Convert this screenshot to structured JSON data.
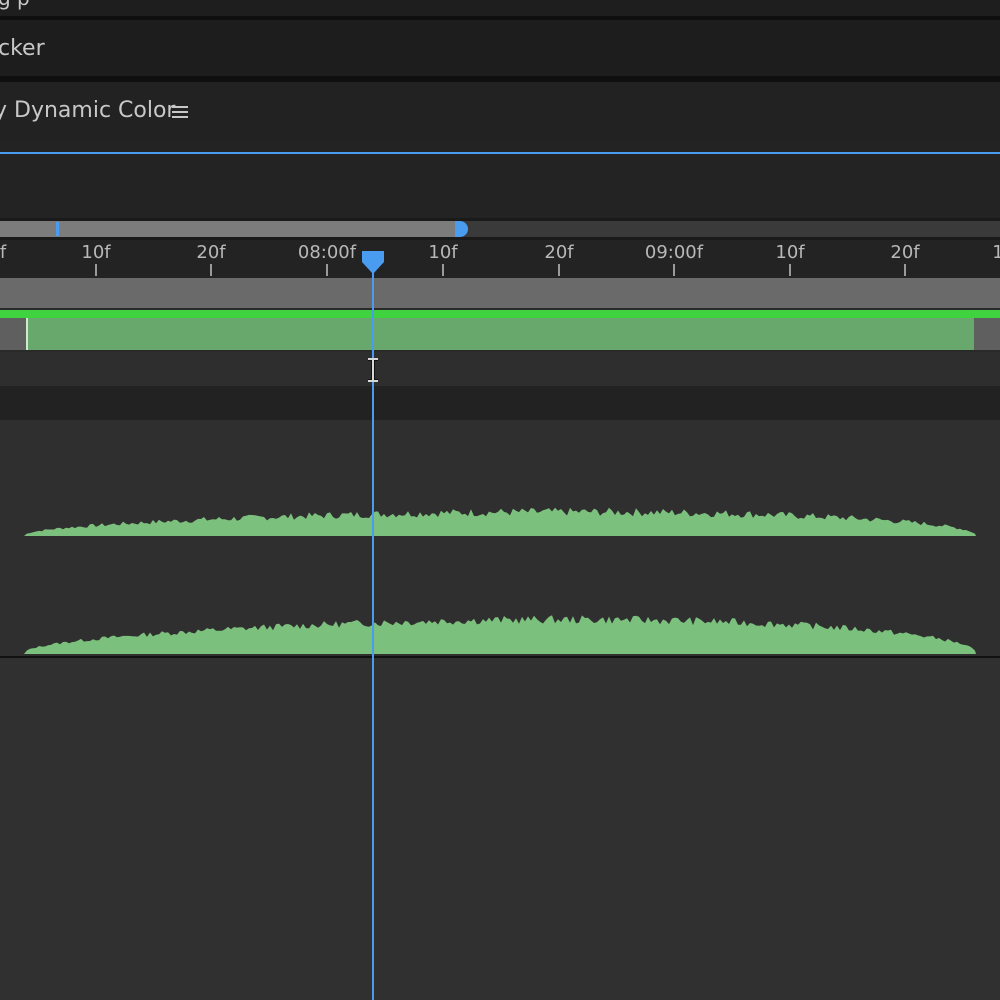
{
  "panels": {
    "top_partial": "g p",
    "tracker_label": "cker",
    "comp_title": "y Dynamic Color",
    "menu_icon": "hamburger-menu-icon"
  },
  "timeline": {
    "ruler_labels": [
      "f",
      "10f",
      "20f",
      "08:00f",
      "10f",
      "20f",
      "09:00f",
      "10f",
      "20f",
      "1"
    ],
    "playhead_icon": "playhead-marker-icon",
    "work_area_end_icon": "work-area-end-handle-icon",
    "cursor_icon": "text-ibeam-cursor-icon"
  },
  "colors": {
    "accent": "#4a9cf0",
    "layer_bar": "#69a86c",
    "layer_bar_border": "#3fd43f",
    "waveform": "#7cc07d",
    "background": "#232323"
  }
}
